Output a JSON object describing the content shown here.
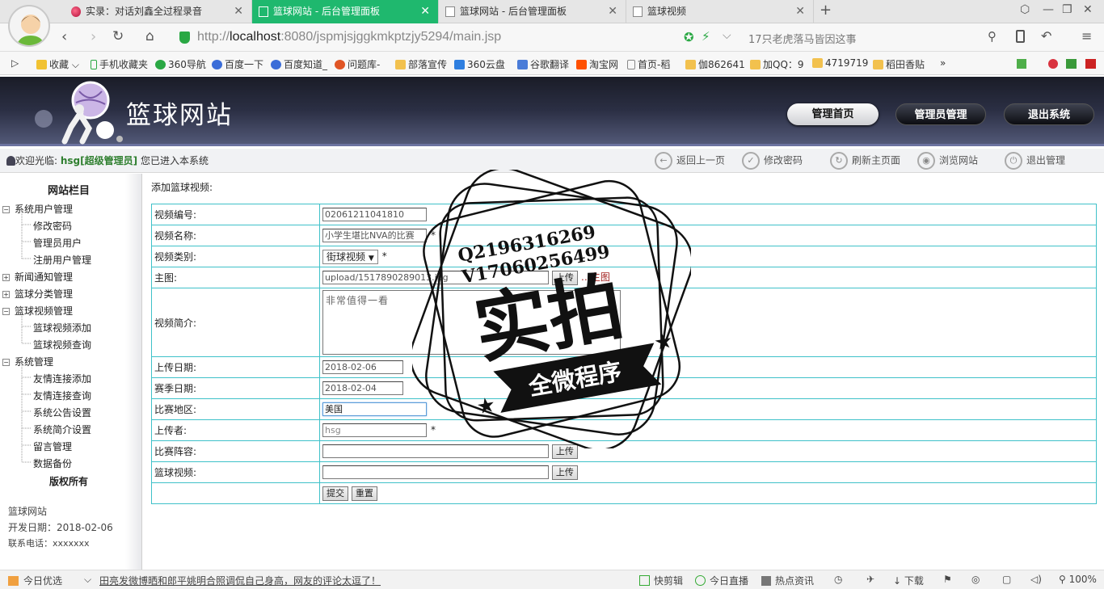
{
  "browser": {
    "tabs": [
      {
        "title": "实录：对话刘鑫全过程录音"
      },
      {
        "title": "篮球网站 - 后台管理面板"
      },
      {
        "title": "篮球网站 - 后台管理面板"
      },
      {
        "title": "篮球视频"
      }
    ],
    "url_prefix": "http://",
    "url_host": "localhost",
    "url_rest": ":8080/jspmjsjggkmkptzjy5294/main.jsp",
    "search_text": "17只老虎落马皆因这事",
    "bookmarks": [
      "收藏",
      "手机收藏夹",
      "360导航",
      "百度一下",
      "百度知道_",
      "问题库-",
      "部落宣传",
      "360云盘",
      "谷歌翻译",
      "淘宝网",
      "首页-稻",
      "伽862641",
      "加QQ：9",
      "4719719",
      "稻田香贴"
    ]
  },
  "site": {
    "title": "篮球网站",
    "nav": [
      "管理首页",
      "管理员管理",
      "退出系统"
    ],
    "welcome_prefix": "欢迎光临:",
    "user": "hsg[超级管理员]",
    "welcome_suffix": "您已进入本系统",
    "toolbar": [
      "返回上一页",
      "修改密码",
      "刷新主页面",
      "浏览网站",
      "退出管理"
    ]
  },
  "sidebar": {
    "title": "网站栏目",
    "groups": [
      {
        "label": "系统用户管理",
        "items": [
          "修改密码",
          "管理员用户",
          "注册用户管理"
        ]
      },
      {
        "label": "新闻通知管理",
        "items": []
      },
      {
        "label": "篮球分类管理",
        "items": []
      },
      {
        "label": "篮球视频管理",
        "items": [
          "篮球视频添加",
          "篮球视频查询"
        ]
      },
      {
        "label": "系统管理",
        "items": [
          "友情连接添加",
          "友情连接查询",
          "系统公告设置",
          "系统简介设置",
          "留言管理",
          "数据备份"
        ]
      }
    ],
    "copyright": "版权所有",
    "site_name": "篮球网站",
    "dev_date": "开发日期：2018-02-06",
    "phone": "联系电话：xxxxxxx"
  },
  "form": {
    "title": "添加篮球视频:",
    "labels": {
      "code": "视频编号:",
      "name": "视频名称:",
      "category": "视频类别:",
      "image": "主图:",
      "intro": "视频简介:",
      "upload_date": "上传日期:",
      "season_date": "赛季日期:",
      "region": "比赛地区:",
      "uploader": "上传者:",
      "lineup": "比赛阵容:",
      "video": "篮球视频:"
    },
    "values": {
      "code": "02061211041810",
      "name": "小学生堪比NVA的比赛",
      "category": "街球视频",
      "image": "upload/1517890289013.jpg",
      "intro": "非常值得一看",
      "upload_date": "2018-02-06",
      "season_date": "2018-02-04",
      "region": "美国",
      "uploader": "hsg",
      "lineup": "",
      "video": ""
    },
    "required_mark": "*",
    "upload_label": "上传",
    "preview_link": "…主图",
    "submit_label": "提交",
    "reset_label": "重置"
  },
  "watermark": {
    "line1": "Q2196316269",
    "line2": "V17060256499",
    "big": "实拍",
    "banner": "全微程序"
  },
  "statusbar": {
    "today": "今日优选",
    "news": "田亮发微博晒和郎平姚明合照调侃自己身高，网友的评论太逗了！",
    "items": [
      "快剪辑",
      "今日直播",
      "热点资讯",
      "下载"
    ],
    "zoom": "100%"
  },
  "colors": {
    "active_tab": "#1fb86e",
    "form_border": "#3fc1c9",
    "user_name": "#2f7f2f"
  }
}
